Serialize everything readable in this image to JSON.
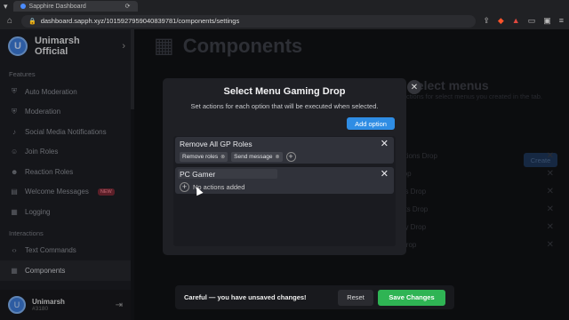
{
  "browser": {
    "tab_title": "Sapphire Dashboard",
    "url": "dashboard.sapph.xyz/1015927959040839781/components/settings"
  },
  "sidebar": {
    "server_name": "Unimarsh Official",
    "logo_letter": "U",
    "sections": [
      {
        "title": "Features",
        "items": [
          {
            "label": "Auto Moderation",
            "icon": "shield-icon"
          },
          {
            "label": "Moderation",
            "icon": "shield-icon"
          },
          {
            "label": "Social Media Notifications",
            "icon": "bell-icon"
          },
          {
            "label": "Join Roles",
            "icon": "user-plus-icon"
          },
          {
            "label": "Reaction Roles",
            "icon": "smile-icon"
          },
          {
            "label": "Welcome Messages",
            "icon": "chat-icon",
            "badge": "NEW"
          },
          {
            "label": "Logging",
            "icon": "list-icon"
          }
        ]
      },
      {
        "title": "Interactions",
        "items": [
          {
            "label": "Text Commands",
            "icon": "code-icon"
          },
          {
            "label": "Components",
            "icon": "grid-icon",
            "active": true
          }
        ]
      }
    ],
    "user": {
      "name": "Unimarsh",
      "tag": "#3180"
    }
  },
  "page": {
    "title": "Components",
    "background_card": {
      "heading": "select menus",
      "description": "ctions for select menus you created in the tab.",
      "create_label": "Create",
      "rows": [
        "ations Drop",
        "rop",
        "ns Drop",
        "nts Drop",
        "ay Drop",
        "Drop"
      ]
    }
  },
  "modal": {
    "title": "Select Menu Gaming Drop",
    "description": "Set actions for each option that will be executed when selected.",
    "add_option_label": "Add option",
    "options": [
      {
        "name": "Remove All GP Roles",
        "actions": [
          "Remove roles",
          "Send message"
        ]
      },
      {
        "name": "PC Gamer",
        "actions": [],
        "empty_text": "No actions added"
      }
    ]
  },
  "savebar": {
    "message": "Careful — you have unsaved changes!",
    "reset_label": "Reset",
    "save_label": "Save Changes"
  },
  "colors": {
    "accent_blue": "#2f8de4",
    "save_green": "#2fb454",
    "new_badge": "#ff8a9a"
  }
}
